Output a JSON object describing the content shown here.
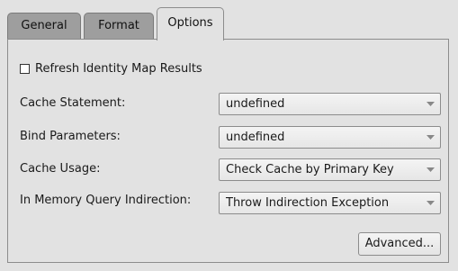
{
  "tabs": [
    {
      "label": "General"
    },
    {
      "label": "Format"
    },
    {
      "label": "Options",
      "active": true
    }
  ],
  "options": {
    "refresh_identity_map": {
      "label": "Refresh Identity Map Results",
      "checked": false
    },
    "cache_statement": {
      "label": "Cache Statement:",
      "value": "undefined"
    },
    "bind_parameters": {
      "label": "Bind Parameters:",
      "value": "undefined"
    },
    "cache_usage": {
      "label": "Cache Usage:",
      "value": "Check Cache by Primary Key"
    },
    "in_memory_query_indirection": {
      "label": "In Memory Query Indirection:",
      "value": "Throw Indirection Exception"
    }
  },
  "advanced_button_label": "Advanced...",
  "colors": {
    "tab_inactive": "#9e9e9e",
    "panel_bg": "#e2e2e2",
    "border": "#8c8c8c"
  }
}
